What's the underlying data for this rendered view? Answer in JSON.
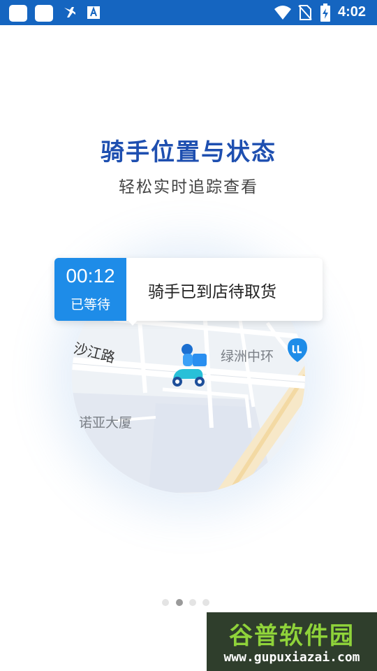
{
  "status_bar": {
    "time": "4:02",
    "icons": [
      "app-square-icon",
      "app-square-icon",
      "airplane-icon",
      "font-a-icon",
      "wifi-icon",
      "no-sim-icon",
      "battery-charging-icon"
    ]
  },
  "intro": {
    "title": "骑手位置与状态",
    "subtitle": "轻松实时追踪查看"
  },
  "card": {
    "timer": "00:12",
    "state": "已等待",
    "message": "骑手已到店待取货"
  },
  "map": {
    "road_label": "沙江路",
    "place_label_1": "绿洲中环",
    "place_label_2": "诺亚大厦"
  },
  "pager": {
    "count": 4,
    "active_index": 1
  },
  "watermark": {
    "name": "谷普软件园",
    "url": "www.gupuxiazai.com"
  },
  "colors": {
    "status_bar": "#1565C0",
    "title": "#1e4fb0",
    "card_accent": "#1e8ce8"
  }
}
